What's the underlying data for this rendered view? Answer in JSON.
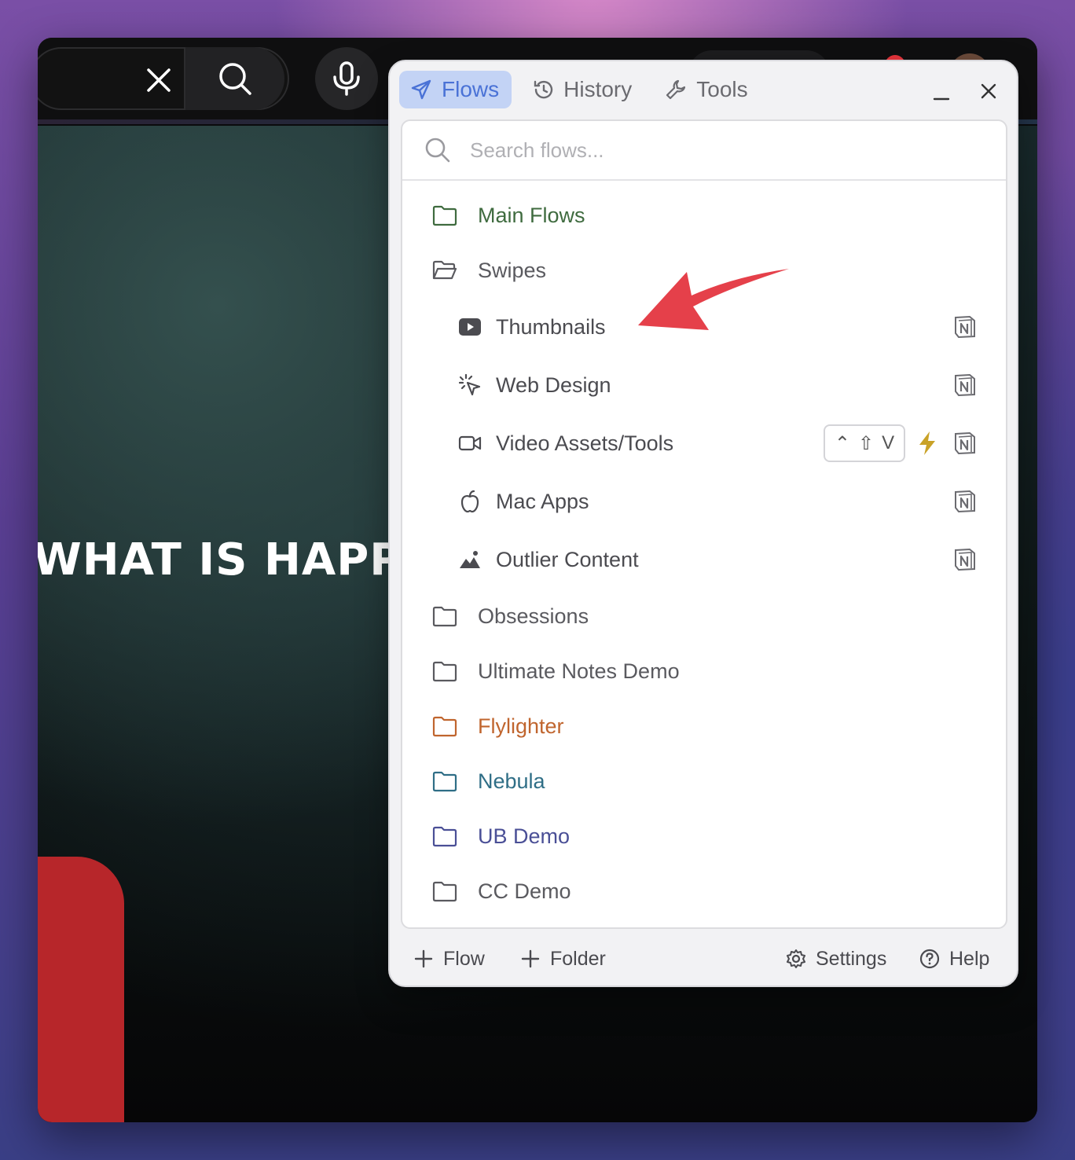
{
  "browser": {
    "video_caption": "WHAT IS HAPPENI"
  },
  "panel": {
    "tabs": [
      {
        "label": "Flows",
        "icon": "send-icon",
        "active": true
      },
      {
        "label": "History",
        "icon": "history-icon",
        "active": false
      },
      {
        "label": "Tools",
        "icon": "wrench-icon",
        "active": false
      }
    ],
    "search": {
      "placeholder": "Search flows...",
      "value": ""
    },
    "items": [
      {
        "label": "Main Flows",
        "type": "folder",
        "color": "#3f6b3f"
      },
      {
        "label": "Swipes",
        "type": "folder-open",
        "color": "#5a5a5f"
      },
      {
        "label": "Thumbnails",
        "type": "flow",
        "icon": "youtube-icon"
      },
      {
        "label": "Web Design",
        "type": "flow",
        "icon": "cursor-click-icon"
      },
      {
        "label": "Video Assets/Tools",
        "type": "flow",
        "icon": "video-camera-icon",
        "shortcut": [
          "⌃",
          "⇧",
          "V"
        ]
      },
      {
        "label": "Mac Apps",
        "type": "flow",
        "icon": "apple-icon"
      },
      {
        "label": "Outlier Content",
        "type": "flow",
        "icon": "landscape-icon"
      },
      {
        "label": "Obsessions",
        "type": "folder",
        "color": "#5a5a5f"
      },
      {
        "label": "Ultimate Notes Demo",
        "type": "folder",
        "color": "#5a5a5f"
      },
      {
        "label": "Flylighter",
        "type": "folder",
        "color": "#c0652e"
      },
      {
        "label": "Nebula",
        "type": "folder",
        "color": "#2f6e86"
      },
      {
        "label": "UB Demo",
        "type": "folder",
        "color": "#4a4f96"
      },
      {
        "label": "CC Demo",
        "type": "folder",
        "color": "#5a5a5f"
      }
    ],
    "footer": {
      "add_flow": "Flow",
      "add_folder": "Folder",
      "settings": "Settings",
      "help": "Help"
    }
  },
  "colors": {
    "accent": "#4a72d6",
    "accent_bg": "#c3d3f5",
    "arrow": "#e5404a",
    "bolt": "#c9a227"
  }
}
